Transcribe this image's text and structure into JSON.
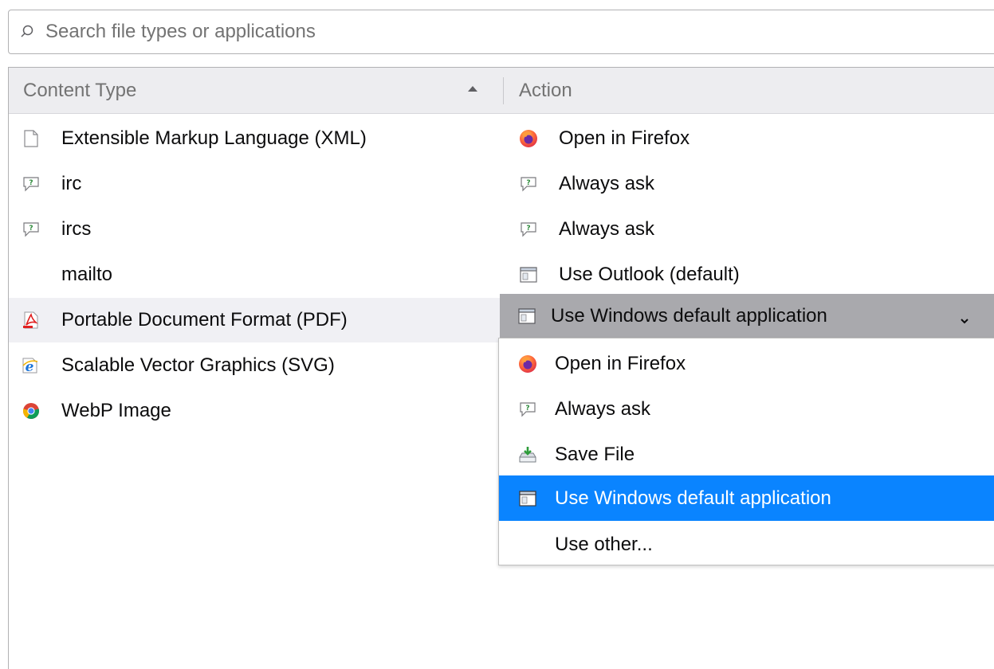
{
  "search": {
    "placeholder": "Search file types or applications"
  },
  "header": {
    "content_type": "Content Type",
    "action": "Action"
  },
  "rows": [
    {
      "type": "Extensible Markup Language (XML)",
      "type_icon": "file-icon",
      "action": "Open in Firefox",
      "action_icon": "firefox-icon"
    },
    {
      "type": "irc",
      "type_icon": "ask-icon",
      "action": "Always ask",
      "action_icon": "ask-icon"
    },
    {
      "type": "ircs",
      "type_icon": "ask-icon",
      "action": "Always ask",
      "action_icon": "ask-icon"
    },
    {
      "type": "mailto",
      "type_icon": "",
      "action": "Use Outlook (default)",
      "action_icon": "app-window-icon"
    },
    {
      "type": "Portable Document Format (PDF)",
      "type_icon": "pdf-icon",
      "action": "Use Windows default application",
      "action_icon": "app-window-icon"
    },
    {
      "type": "Scalable Vector Graphics (SVG)",
      "type_icon": "internet-explorer-icon",
      "action": "",
      "action_icon": ""
    },
    {
      "type": "WebP Image",
      "type_icon": "chrome-icon",
      "action": "",
      "action_icon": ""
    }
  ],
  "dropdown": {
    "items": [
      {
        "label": "Open in Firefox",
        "icon": "firefox-icon"
      },
      {
        "label": "Always ask",
        "icon": "ask-icon"
      },
      {
        "label": "Save File",
        "icon": "save-file-icon"
      },
      {
        "label": "Use Windows default application",
        "icon": "app-window-icon",
        "highlighted": true
      },
      {
        "label": "Use other...",
        "icon": ""
      }
    ]
  },
  "colors": {
    "highlight": "#0a84ff",
    "selected_row": "#f0f0f4",
    "select_box": "#a9a9ad",
    "header_bg": "#ededf0"
  }
}
